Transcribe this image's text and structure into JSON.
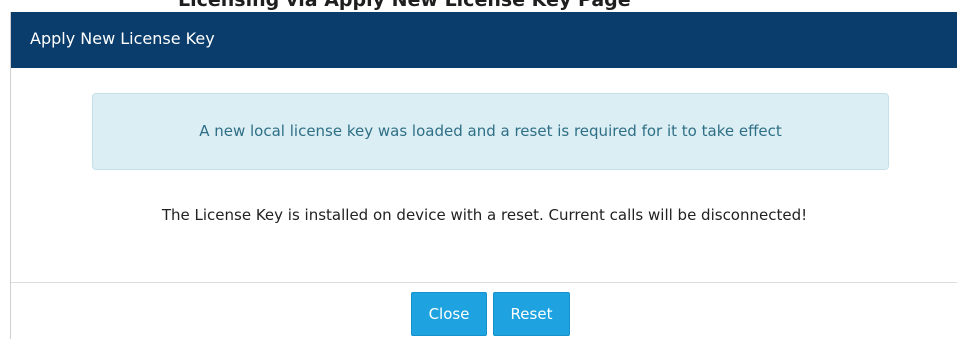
{
  "page_heading": "Licensing via Apply New License Key Page",
  "dialog": {
    "title": "Apply New License Key",
    "info_message": "A new local license key was loaded and a reset is required for it to take effect",
    "warning_message": "The License Key is installed on device with a reset. Current calls will be disconnected!",
    "buttons": {
      "close_label": "Close",
      "reset_label": "Reset"
    }
  },
  "colors": {
    "header_background": "#0a3d6b",
    "info_background": "#dbeef4",
    "info_text": "#2f6f86",
    "button_primary": "#1ea3e0"
  }
}
